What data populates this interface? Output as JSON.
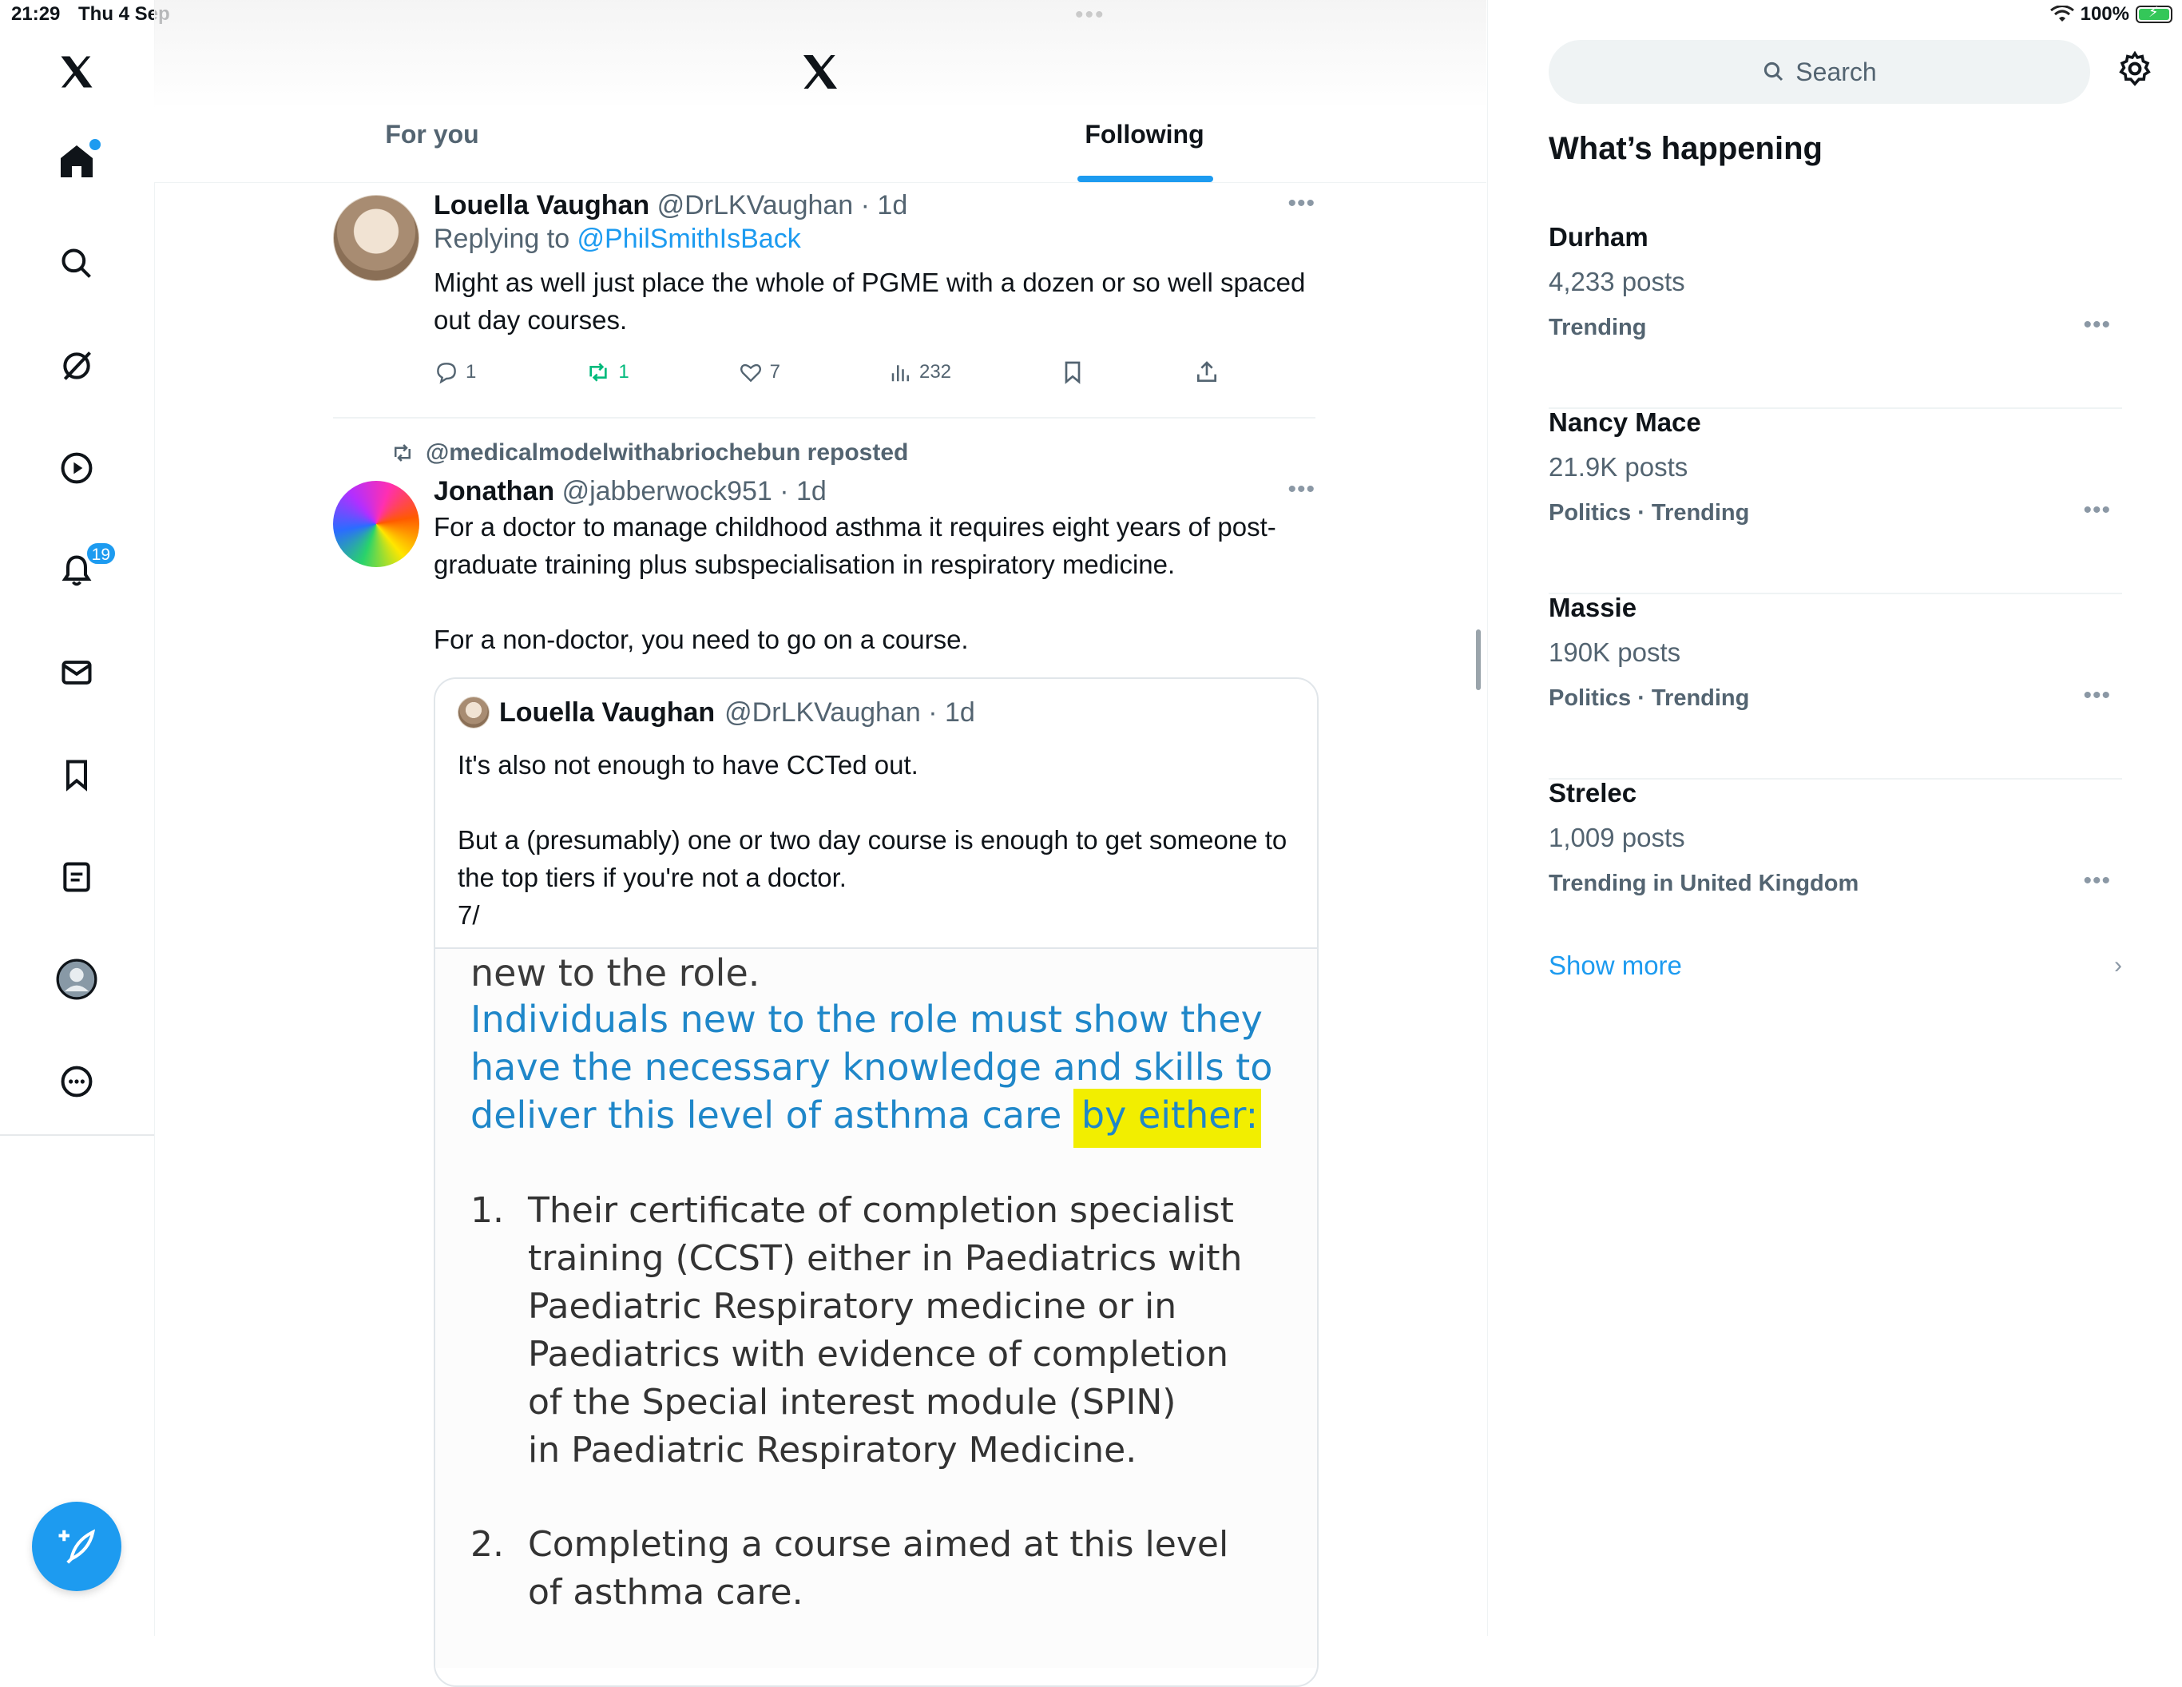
{
  "status_bar": {
    "time": "21:29",
    "date": "Thu 4 Sep",
    "battery": "100%"
  },
  "colors": {
    "accent": "#1d9bf0",
    "repost_green": "#00ba7c",
    "highlight": "#f2ee00"
  },
  "nav": {
    "icons": [
      "x-logo-icon",
      "home-icon",
      "search-icon",
      "grok-icon",
      "video-icon",
      "notifications-icon",
      "messages-icon",
      "bookmarks-icon",
      "lists-icon",
      "profile-icon",
      "more-icon"
    ],
    "notifications_badge": "19"
  },
  "header": {
    "tabs": [
      {
        "label": "For you"
      },
      {
        "label": "Following"
      }
    ]
  },
  "feed": {
    "tweet1": {
      "name": "Louella Vaughan",
      "handle": "@DrLKVaughan · 1d",
      "replying_prefix": "Replying to ",
      "replying_to": "@PhilSmithIsBack",
      "text": "Might as well just place the whole of PGME with a dozen or so well spaced out day courses.",
      "replies": "1",
      "reposts": "1",
      "likes": "7",
      "views": "232"
    },
    "tweet2": {
      "repost_label": "@medicalmodelwithabriochebun reposted",
      "name": "Jonathan",
      "handle": "@jabberwock951 · 1d",
      "text": "For a doctor to manage childhood asthma it requires eight years of post-graduate training plus subspecialisation in respiratory medicine.\n\nFor a non-doctor, you need to go on a course.",
      "quote": {
        "name": "Louella Vaughan",
        "handle": "@DrLKVaughan · 1d",
        "text": "It's also not enough to have CCTed out.\n\nBut a (presumably) one or two day course is enough to get someone to the top tiers if you're not a doctor.\n7/",
        "image": {
          "top_line": "new to the role.",
          "blue_text": "Individuals new to the role must show they have the necessary knowledge and skills to deliver this level of asthma care ",
          "highlighted": "by either:",
          "list": [
            {
              "num": "1.",
              "text": "Their certificate of completion specialist\ntraining (CCST) either in Paediatrics with\nPaediatric Respiratory medicine or in\nPaediatrics with evidence of completion\nof the Special interest module (SPIN)\nin Paediatric Respiratory Medicine."
            },
            {
              "num": "2.",
              "text": "Completing a course aimed at this level\nof asthma care."
            }
          ]
        }
      }
    }
  },
  "sidebar": {
    "search_placeholder": "Search",
    "title": "What’s happening",
    "trends": [
      {
        "name": "Durham",
        "count": "4,233 posts",
        "meta": "Trending"
      },
      {
        "name": "Nancy Mace",
        "count": "21.9K posts",
        "meta": "Politics · Trending"
      },
      {
        "name": "Massie",
        "count": "190K posts",
        "meta": "Politics · Trending"
      },
      {
        "name": "Strelec",
        "count": "1,009 posts",
        "meta": "Trending in United Kingdom"
      }
    ],
    "show_more": "Show more"
  }
}
